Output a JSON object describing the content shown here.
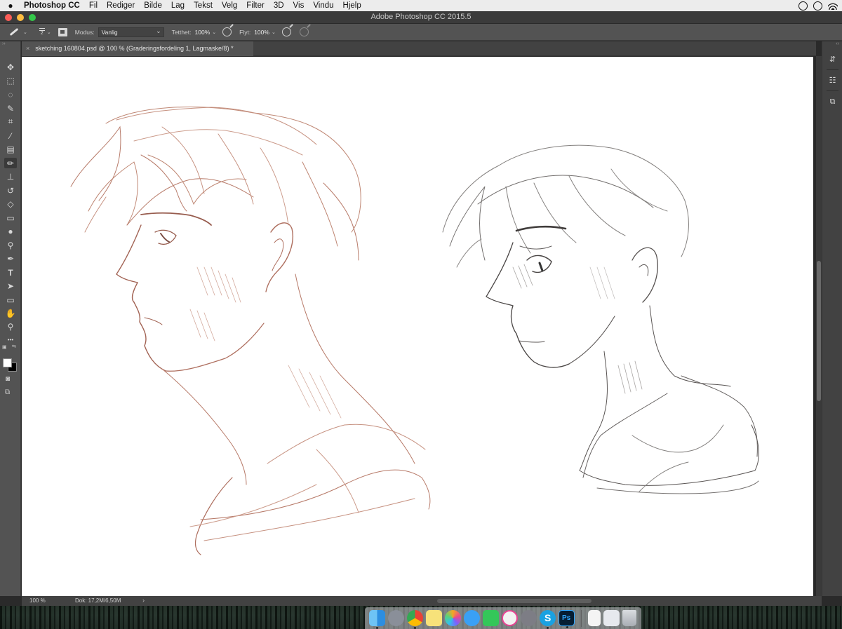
{
  "menubar": {
    "app_name": "Photoshop CC",
    "items": [
      "Fil",
      "Rediger",
      "Bilde",
      "Lag",
      "Tekst",
      "Velg",
      "Filter",
      "3D",
      "Vis",
      "Vindu",
      "Hjelp"
    ]
  },
  "window": {
    "title": "Adobe Photoshop CC 2015.5"
  },
  "options": {
    "brush_size": "2",
    "mode_label": "Modus:",
    "mode_value": "Vanlig",
    "opacity_label": "Tetthet:",
    "opacity_value": "100%",
    "flow_label": "Flyt:",
    "flow_value": "100%"
  },
  "document_tab": {
    "close_glyph": "×",
    "title": "sketching 160804.psd @ 100 % (Graderingsfordeling 1, Lagmaske/8) *"
  },
  "statusbar": {
    "zoom": "100 %",
    "doc_size": "Dok: 17,2M/6,50M",
    "arrow": "›"
  },
  "tools": [
    {
      "name": "move-tool",
      "glyph": "✥"
    },
    {
      "name": "marquee-tool",
      "glyph": "⬚"
    },
    {
      "name": "lasso-tool",
      "glyph": "◌"
    },
    {
      "name": "quick-select-tool",
      "glyph": "✎"
    },
    {
      "name": "crop-tool",
      "glyph": "⌗"
    },
    {
      "name": "eyedropper-tool",
      "glyph": "⁄"
    },
    {
      "name": "healing-brush-tool",
      "glyph": "▤"
    },
    {
      "name": "brush-tool",
      "glyph": "✏"
    },
    {
      "name": "clone-stamp-tool",
      "glyph": "⊥"
    },
    {
      "name": "history-brush-tool",
      "glyph": "↺"
    },
    {
      "name": "eraser-tool",
      "glyph": "◇"
    },
    {
      "name": "gradient-tool",
      "glyph": "▭"
    },
    {
      "name": "blur-tool",
      "glyph": "●"
    },
    {
      "name": "dodge-tool",
      "glyph": "⚲"
    },
    {
      "name": "pen-tool",
      "glyph": "✒"
    },
    {
      "name": "type-tool",
      "glyph": "T"
    },
    {
      "name": "path-select-tool",
      "glyph": "➤"
    },
    {
      "name": "rectangle-tool",
      "glyph": "▭"
    },
    {
      "name": "hand-tool",
      "glyph": "✋"
    },
    {
      "name": "zoom-tool",
      "glyph": "⚲"
    },
    {
      "name": "more-tools",
      "glyph": "•••"
    }
  ],
  "colors": {
    "foreground": "#ffffff",
    "background": "#000000",
    "sketch_left": "#9a4a36",
    "sketch_right": "#3b3634"
  },
  "dock_apps": [
    "finder",
    "launchpad",
    "chrome",
    "notes",
    "photos",
    "messages",
    "facetime",
    "itunes",
    "system-preferences",
    "skype",
    "photoshop",
    "document",
    "preview",
    "trash"
  ],
  "dock_labels": {
    "photoshop": "Ps",
    "skype": "S"
  }
}
